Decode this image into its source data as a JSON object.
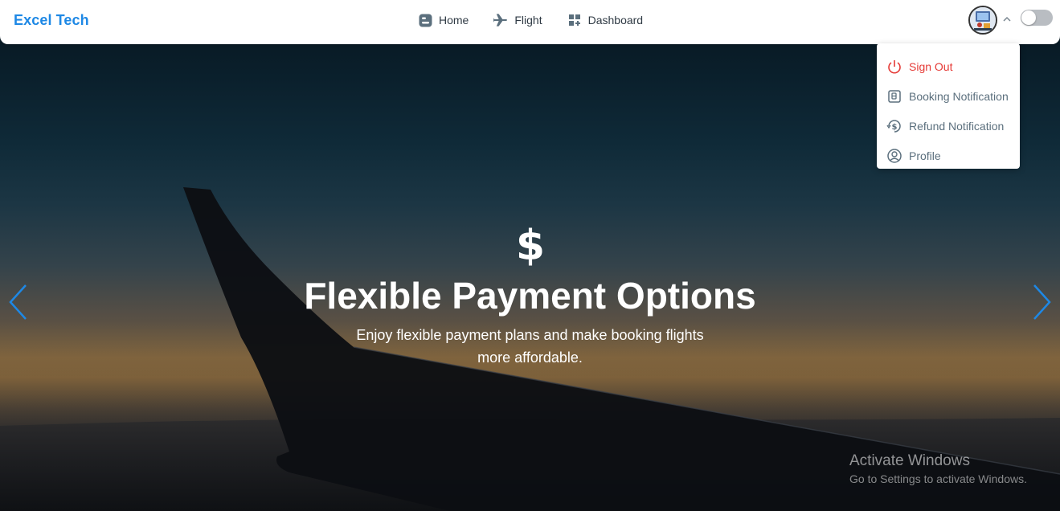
{
  "brand": {
    "name": "Excel Tech",
    "color": "#1e88e5"
  },
  "nav": {
    "items": [
      {
        "label": "Home",
        "icon": "blog-icon"
      },
      {
        "label": "Flight",
        "icon": "airplane-icon"
      },
      {
        "label": "Dashboard",
        "icon": "dashboard-icon"
      }
    ]
  },
  "user_menu": {
    "avatar": "user-avatar",
    "expanded": true,
    "dark_mode": false,
    "items": [
      {
        "label": "Sign Out",
        "icon": "power-icon",
        "color": "#e53935"
      },
      {
        "label": "Booking Notification",
        "icon": "booking-icon"
      },
      {
        "label": "Refund Notification",
        "icon": "refund-icon"
      },
      {
        "label": "Profile",
        "icon": "profile-icon"
      }
    ]
  },
  "slide": {
    "icon": "dollar-icon",
    "title": "Flexible Payment Options",
    "subtitle": "Enjoy flexible payment plans and make booking flights more affordable.",
    "arrow_color": "#1e88e5"
  },
  "watermark": {
    "title": "Activate Windows",
    "subtitle": "Go to Settings to activate Windows."
  }
}
